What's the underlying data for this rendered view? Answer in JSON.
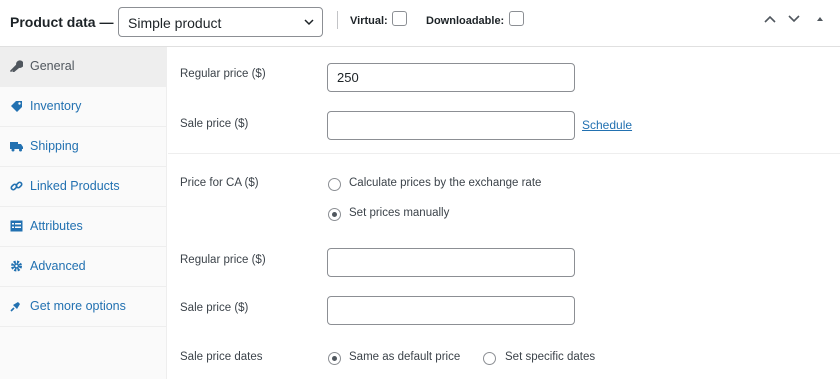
{
  "header": {
    "title": "Product data —",
    "product_type": "Simple product",
    "virtual_label": "Virtual:",
    "virtual_checked": false,
    "downloadable_label": "Downloadable:",
    "downloadable_checked": false
  },
  "tabs": [
    {
      "label": "General",
      "icon": "wrench-icon",
      "active": true
    },
    {
      "label": "Inventory",
      "icon": "tag-icon",
      "active": false
    },
    {
      "label": "Shipping",
      "icon": "truck-icon",
      "active": false
    },
    {
      "label": "Linked Products",
      "icon": "link-icon",
      "active": false
    },
    {
      "label": "Attributes",
      "icon": "list-icon",
      "active": false
    },
    {
      "label": "Advanced",
      "icon": "gear-icon",
      "active": false
    },
    {
      "label": "Get more options",
      "icon": "plugin-icon",
      "active": false
    }
  ],
  "pricing": {
    "regular_price_label": "Regular price ($)",
    "regular_price_value": "250",
    "sale_price_label": "Sale price ($)",
    "sale_price_value": "",
    "schedule_link": "Schedule"
  },
  "ca_pricing": {
    "price_for_label": "Price for CA ($)",
    "option_exchange": "Calculate prices by the exchange rate",
    "option_manual": "Set prices manually",
    "selected_option": "manual",
    "regular_price_label": "Regular price ($)",
    "regular_price_value": "",
    "sale_price_label": "Sale price ($)",
    "sale_price_value": "",
    "sale_dates_label": "Sale price dates",
    "dates_option_default": "Same as default price",
    "dates_option_specific": "Set specific dates",
    "dates_selected": "default"
  },
  "colors": {
    "link": "#2271b1",
    "active_tab_bg": "#eeeeee",
    "border": "#8c8f94"
  }
}
